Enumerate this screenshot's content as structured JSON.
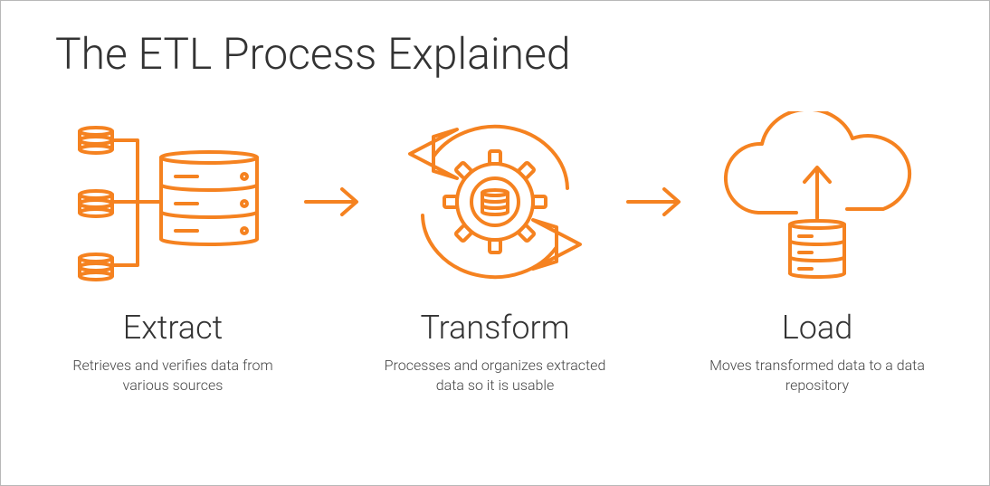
{
  "title": "The ETL Process Explained",
  "accent": "#F58220",
  "stages": [
    {
      "name": "Extract",
      "desc": "Retrieves and verifies data from various sources"
    },
    {
      "name": "Transform",
      "desc": "Processes and organizes extracted data so it is usable"
    },
    {
      "name": "Load",
      "desc": "Moves transformed data to a data repository"
    }
  ]
}
